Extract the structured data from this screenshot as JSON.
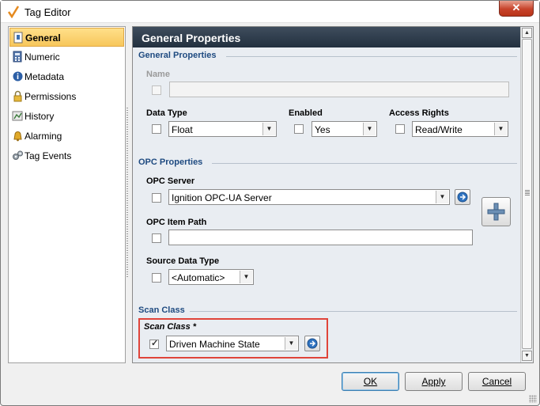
{
  "window": {
    "title": "Tag Editor",
    "close_label": "✕"
  },
  "nav": {
    "items": [
      {
        "label": "General",
        "icon": "document-info-icon",
        "selected": true
      },
      {
        "label": "Numeric",
        "icon": "calculator-icon",
        "selected": false
      },
      {
        "label": "Metadata",
        "icon": "info-icon",
        "selected": false
      },
      {
        "label": "Permissions",
        "icon": "lock-icon",
        "selected": false
      },
      {
        "label": "History",
        "icon": "history-icon",
        "selected": false
      },
      {
        "label": "Alarming",
        "icon": "bell-icon",
        "selected": false
      },
      {
        "label": "Tag Events",
        "icon": "gears-icon",
        "selected": false
      }
    ]
  },
  "panel": {
    "header": "General Properties",
    "general": {
      "section_title": "General Properties",
      "name_label": "Name",
      "name_value": "",
      "data_type_label": "Data Type",
      "data_type_value": "Float",
      "enabled_label": "Enabled",
      "enabled_value": "Yes",
      "access_rights_label": "Access Rights",
      "access_rights_value": "Read/Write"
    },
    "opc": {
      "section_title": "OPC Properties",
      "server_label": "OPC Server",
      "server_value": "Ignition OPC-UA Server",
      "item_path_label": "OPC Item Path",
      "item_path_value": "",
      "source_type_label": "Source Data Type",
      "source_type_value": "<Automatic>"
    },
    "scan": {
      "section_title": "Scan Class",
      "label": "Scan Class *",
      "value": "Driven Machine State",
      "checked": true
    }
  },
  "buttons": {
    "ok": "OK",
    "apply": "Apply",
    "cancel": "Cancel"
  },
  "colors": {
    "accent_header": "#2c3a4a",
    "section_title": "#1e4a80",
    "highlight": "#e0443a",
    "selected_nav": "#f7c65b"
  }
}
